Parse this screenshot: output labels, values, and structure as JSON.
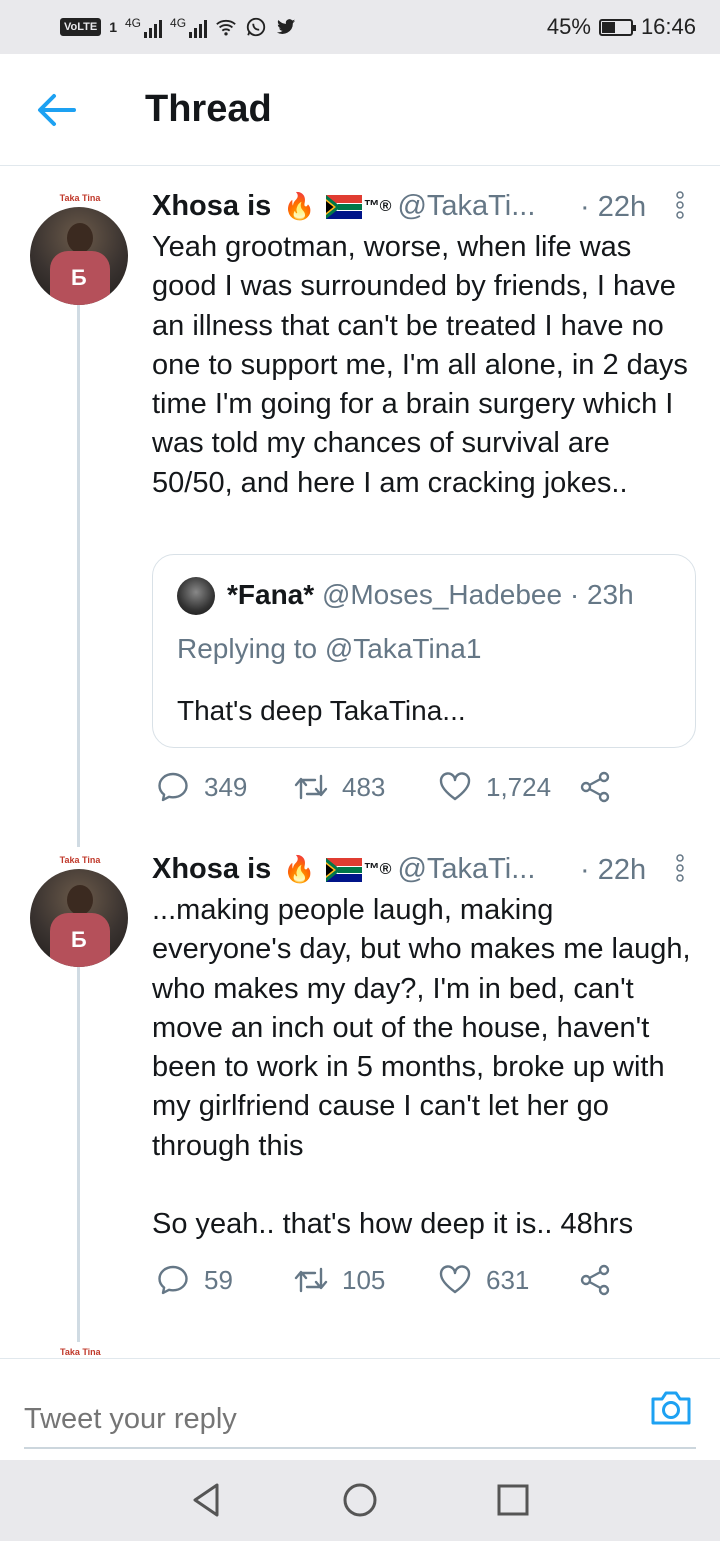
{
  "status_bar": {
    "volte": "VoLTE",
    "sim": "1",
    "network1": "4G",
    "network2": "4G",
    "battery": "45%",
    "battery_level": 0.45,
    "time": "16:46",
    "icons": [
      "wifi-icon",
      "whatsapp-icon",
      "twitter-icon"
    ]
  },
  "header": {
    "title": "Thread"
  },
  "tweets": [
    {
      "avatar_tag": "Taka Tina",
      "name": "Xhosa is",
      "emoji_fire": "🔥",
      "tm": "™®",
      "handle": "@TakaTi...",
      "time": "· 22h",
      "text": "Yeah grootman, worse, when life was good I was surrounded by friends, I have an illness that can't be treated I have no one to support me, I'm all alone, in 2 days time I'm going for a brain surgery which I was told my chances of survival are 50/50, and here I am cracking jokes..",
      "quote": {
        "name": "*Fana*",
        "handle": "@Moses_Hadebee · 23h",
        "replying_to": "Replying to @TakaTina1",
        "text": "That's deep TakaTina..."
      },
      "replies": "349",
      "retweets": "483",
      "likes": "1,724"
    },
    {
      "avatar_tag": "Taka Tina",
      "name": "Xhosa is",
      "emoji_fire": "🔥",
      "tm": "™®",
      "handle": "@TakaTi...",
      "time": "· 22h",
      "text": "...making people laugh, making everyone's day, but who makes me laugh, who makes my day?, I'm in bed, can't move an inch out of the house, haven't been to work in 5 months, broke up with my girlfriend cause I can't let her go through this\n\nSo yeah.. that's how deep it is.. 48hrs",
      "replies": "59",
      "retweets": "105",
      "likes": "631"
    }
  ],
  "next_avatar_tag": "Taka Tina",
  "reply_bar": {
    "placeholder": "Tweet your reply"
  },
  "colors": {
    "accent": "#1da1f2",
    "muted": "#657786",
    "text": "#14171a"
  }
}
